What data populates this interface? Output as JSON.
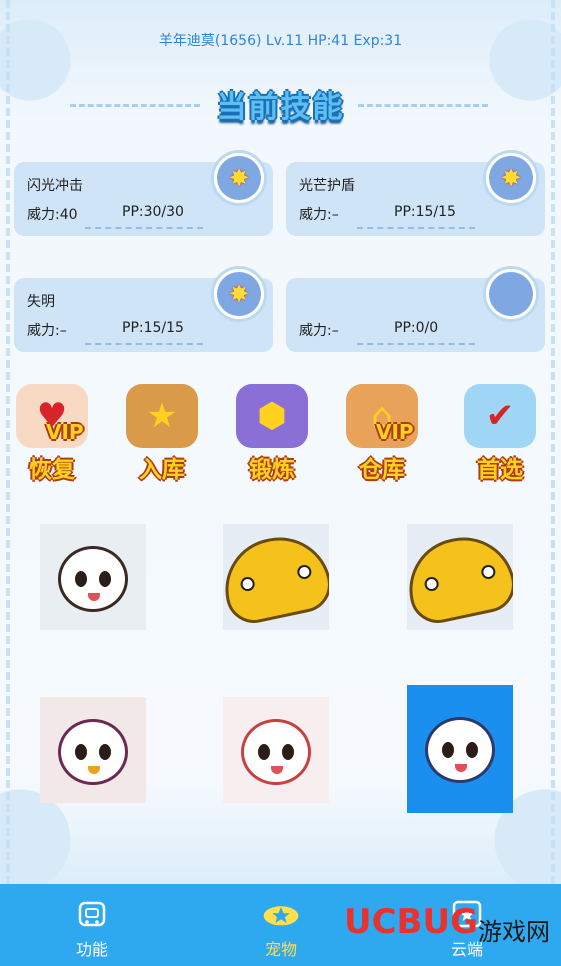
{
  "player": {
    "stats_line": "羊年迪莫(1656) Lv.11 HP:41 Exp:31"
  },
  "header": {
    "title": "当前技能"
  },
  "skills": [
    {
      "name": "闪光冲击",
      "power": "威力:40",
      "pp": "PP:30/30",
      "icon": "explosion-icon"
    },
    {
      "name": "光芒护盾",
      "power": "威力:–",
      "pp": "PP:15/15",
      "icon": "explosion-icon"
    },
    {
      "name": "失明",
      "power": "威力:–",
      "pp": "PP:15/15",
      "icon": "explosion-icon"
    },
    {
      "name": "",
      "power": "威力:–",
      "pp": "PP:0/0",
      "icon": "empty-slot-icon"
    }
  ],
  "actions": [
    {
      "vip": "VIP",
      "label": "恢复",
      "icon": "potion-icon"
    },
    {
      "vip": "",
      "label": "入库",
      "icon": "storage-house-icon"
    },
    {
      "vip": "",
      "label": "锻炼",
      "icon": "dumbbell-icon"
    },
    {
      "vip": "VIP",
      "label": "仓库",
      "icon": "warehouse-icon"
    },
    {
      "vip": "",
      "label": "首选",
      "icon": "check-ball-icon"
    }
  ],
  "tabbar": {
    "tabs": [
      {
        "label": "功能",
        "icon": "robot-icon"
      },
      {
        "label": "宠物",
        "icon": "pet-star-icon"
      },
      {
        "label": "云端",
        "icon": "cloud-icon"
      }
    ],
    "active": "宠物"
  },
  "watermark": {
    "brand": "UCBUG",
    "cn": "游戏网"
  },
  "colors": {
    "tabbar": "#2ea8ef",
    "accent": "#ffd21f",
    "card": "#cfe4f7",
    "stats_text": "#2f86d6"
  }
}
